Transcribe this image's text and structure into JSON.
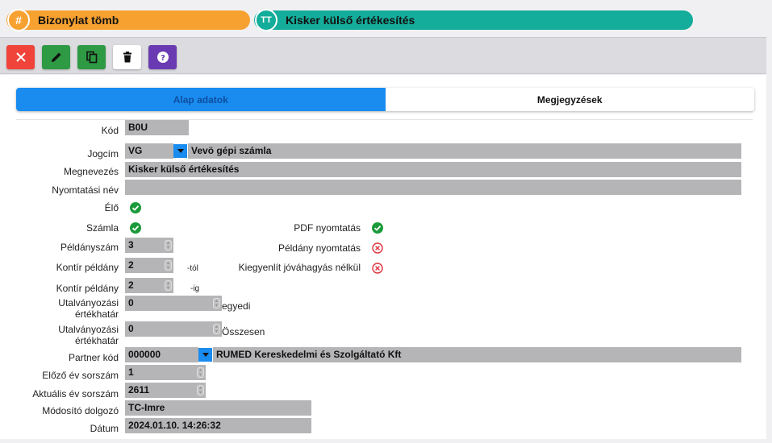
{
  "header": {
    "left_pill": {
      "icon": "hash-icon",
      "icon_glyph": "#",
      "title": "Bizonylat tömb",
      "color": "#f7a131"
    },
    "right_pill": {
      "icon": "text-type-icon",
      "icon_glyph": "TT",
      "title": "Kisker külső értékesítés",
      "color": "#14ac9a"
    }
  },
  "toolbar": {
    "buttons": [
      {
        "name": "close-button",
        "icon": "close-icon",
        "color": "#f0433a"
      },
      {
        "name": "edit-button",
        "icon": "pencil-icon",
        "color": "#2e9a44"
      },
      {
        "name": "copy-button",
        "icon": "copy-icon",
        "color": "#2e9a44"
      },
      {
        "name": "delete-button",
        "icon": "trash-icon",
        "color": "#ffffff"
      },
      {
        "name": "help-button",
        "icon": "question-icon",
        "color": "#6a3ab2"
      }
    ]
  },
  "tabs": {
    "active": "Alap adatok",
    "inactive": "Megjegyzések",
    "active_color": "#1a8cf0"
  },
  "form": {
    "kod": {
      "label": "Kód",
      "value": "B0U"
    },
    "jogcim": {
      "label": "Jogcím",
      "code": "VG",
      "text": "Vevö gépi számla"
    },
    "megnevezes": {
      "label": "Megnevezés",
      "value": "Kisker külső értékesítés"
    },
    "nyomtatasi_nev": {
      "label": "Nyomtatási név",
      "value": ""
    },
    "elo": {
      "label": "Élő",
      "checked": true
    },
    "szamla": {
      "label": "Számla",
      "checked": true
    },
    "pdf_nyomtatas": {
      "label": "PDF nyomtatás",
      "checked": true
    },
    "peldanyszam": {
      "label": "Példányszám",
      "value": "3"
    },
    "peldany_nyomtatas": {
      "label": "Példány nyomtatás",
      "checked": false
    },
    "kontir_tol": {
      "label": "Kontír példány",
      "value": "2",
      "suffix": "-tól"
    },
    "kiegyenlit": {
      "label": "Kiegyenlít jóváhagyás nélkül",
      "checked": false
    },
    "kontir_ig": {
      "label": "Kontír példány",
      "value": "2",
      "suffix": "-ig"
    },
    "utalv_egyedi": {
      "label_line1": "Utalványozási",
      "label_line2": "értékhatár",
      "value": "0",
      "suffix": "egyedi"
    },
    "utalv_osszesen": {
      "label_line1": "Utalványozási",
      "label_line2": "értékhatár",
      "value": "0",
      "suffix": "Összesen"
    },
    "partner_kod": {
      "label": "Partner kód",
      "code": "000000",
      "text": "RUMED Kereskedelmi és Szolgáltató Kft"
    },
    "elozo_ev": {
      "label": "Előző év sorszám",
      "value": "1"
    },
    "aktualis_ev": {
      "label": "Aktuális év sorszám",
      "value": "2611"
    },
    "modosito": {
      "label": "Módosító dolgozó",
      "value": "TC-Imre"
    },
    "datum": {
      "label": "Dátum",
      "value": "2024.01.10. 14:26:32"
    }
  },
  "colors": {
    "check_green": "#1a9a3a",
    "cross_red": "#e0303a"
  }
}
